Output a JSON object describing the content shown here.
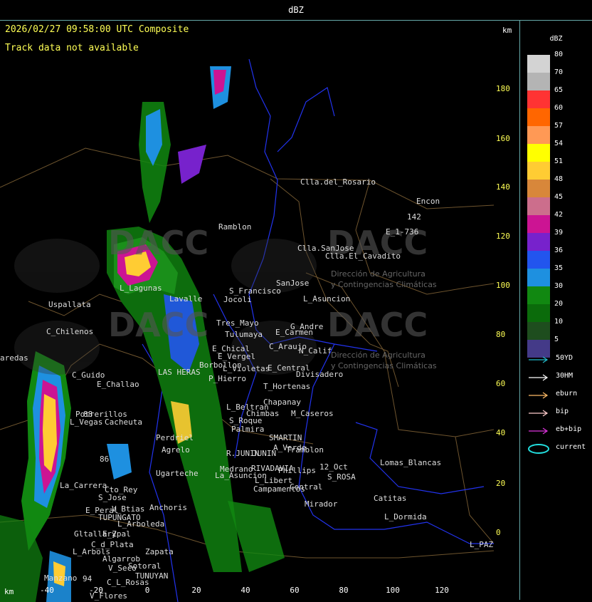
{
  "window": {
    "title": "dBZ"
  },
  "map": {
    "timestamp": "2026/02/27 09:58:00 UTC Composite",
    "track_status": "Track data not available",
    "unit_top": "km",
    "unit_bottom": "km",
    "y_ticks": [
      "180",
      "160",
      "140",
      "120",
      "100",
      "80",
      "60",
      "40",
      "20",
      "0"
    ],
    "x_ticks": [
      "-40",
      "-20",
      "0",
      "20",
      "40",
      "60",
      "80",
      "100",
      "120"
    ],
    "watermark": "DACC",
    "watermark_sub": [
      "Dirección de Agricultura",
      "y Contingencias Climáticas"
    ],
    "places": [
      {
        "name": "Clla.del_Rosario"
      },
      {
        "name": "Encon"
      },
      {
        "name": "142"
      },
      {
        "name": "E_1-736"
      },
      {
        "name": "Ramblon"
      },
      {
        "name": "Clla.SanJose"
      },
      {
        "name": "Clla.El_Cavadito"
      },
      {
        "name": "SanJose"
      },
      {
        "name": "S_Francisco"
      },
      {
        "name": "L_Asuncion"
      },
      {
        "name": "Jocoli"
      },
      {
        "name": "Uspallata"
      },
      {
        "name": "L_Lagunas"
      },
      {
        "name": "Lavalle"
      },
      {
        "name": "Tres_Mayo"
      },
      {
        "name": "G_Andre"
      },
      {
        "name": "E_Carmen"
      },
      {
        "name": "Tulumaya"
      },
      {
        "name": "C_Chilenos"
      },
      {
        "name": "E_Chical"
      },
      {
        "name": "E_Vergel"
      },
      {
        "name": "C_Araujo"
      },
      {
        "name": "N_Calif"
      },
      {
        "name": "aredas"
      },
      {
        "name": "Borbollon"
      },
      {
        "name": "L_Violetas"
      },
      {
        "name": "E_Central"
      },
      {
        "name": "Divisadero"
      },
      {
        "name": "C_Guido"
      },
      {
        "name": "E_Challao"
      },
      {
        "name": "P_Hierro"
      },
      {
        "name": "LAS HERAS"
      },
      {
        "name": "T_Hortenas"
      },
      {
        "name": "Chapanay"
      },
      {
        "name": "L_Beltran"
      },
      {
        "name": "Chimbas"
      },
      {
        "name": "M_Caseros"
      },
      {
        "name": "Potrerillos"
      },
      {
        "name": "L_Vegas"
      },
      {
        "name": "Cacheuta"
      },
      {
        "name": "S_Roque"
      },
      {
        "name": "Palmira"
      },
      {
        "name": "Perdriel"
      },
      {
        "name": "SMARTIN"
      },
      {
        "name": "A_Verde"
      },
      {
        "name": "Tramblon"
      },
      {
        "name": "Agrelo"
      },
      {
        "name": "R.JUNIN"
      },
      {
        "name": "JUNIN"
      },
      {
        "name": "12_Oct"
      },
      {
        "name": "Lomas_Blancas"
      },
      {
        "name": "Medrano"
      },
      {
        "name": "RIVADAVIA"
      },
      {
        "name": "Phillips"
      },
      {
        "name": "Ugarteche"
      },
      {
        "name": "La_Asuncion"
      },
      {
        "name": "S_ROSA"
      },
      {
        "name": "La_Carrera"
      },
      {
        "name": "Cto_Rey"
      },
      {
        "name": "L_Libert"
      },
      {
        "name": "Campamentos"
      },
      {
        "name": "Central"
      },
      {
        "name": "S_Jose"
      },
      {
        "name": "Catitas"
      },
      {
        "name": "Anchoris"
      },
      {
        "name": "E_Peral"
      },
      {
        "name": "V_Btias"
      },
      {
        "name": "TUPUNGATO"
      },
      {
        "name": "Mirador"
      },
      {
        "name": "L_Dormida"
      },
      {
        "name": "L_Arboleda"
      },
      {
        "name": "E_Zpal"
      },
      {
        "name": "Gltallary"
      },
      {
        "name": "L_PAZ"
      },
      {
        "name": "C_d_Plata"
      },
      {
        "name": "L_Arbols"
      },
      {
        "name": "Zapata"
      },
      {
        "name": "Algarrob"
      },
      {
        "name": "V_Seco"
      },
      {
        "name": "Sotoral"
      },
      {
        "name": "TUNUYAN"
      },
      {
        "name": "Manzano"
      },
      {
        "name": "94"
      },
      {
        "name": "C_L_Rosas"
      },
      {
        "name": "V_Flores"
      },
      {
        "name": "88"
      },
      {
        "name": "86"
      }
    ]
  },
  "legend": {
    "title": "dBZ",
    "scale": [
      {
        "label": "80",
        "color": "#d3d3d3"
      },
      {
        "label": "70",
        "color": "#b4b4b4"
      },
      {
        "label": "65",
        "color": "#ff3333"
      },
      {
        "label": "60",
        "color": "#ff6600"
      },
      {
        "label": "57",
        "color": "#ff9955"
      },
      {
        "label": "54",
        "color": "#ffff00"
      },
      {
        "label": "51",
        "color": "#ffcc33"
      },
      {
        "label": "48",
        "color": "#d8873a"
      },
      {
        "label": "45",
        "color": "#cc6e8c"
      },
      {
        "label": "42",
        "color": "#cc1493"
      },
      {
        "label": "39",
        "color": "#7722cc"
      },
      {
        "label": "36",
        "color": "#2255ee"
      },
      {
        "label": "35",
        "color": "#1e90e0"
      },
      {
        "label": "30",
        "color": "#118811"
      },
      {
        "label": "20",
        "color": "#0b6b0b"
      },
      {
        "label": "10",
        "color": "#1e4d1e"
      },
      {
        "label": "5",
        "color": "#443a88"
      }
    ],
    "tracks": [
      {
        "label": "50YD",
        "color": "#22bbcc"
      },
      {
        "label": "30HM",
        "color": "#ffffff"
      },
      {
        "label": "eburn",
        "color": "#ffbb66"
      },
      {
        "label": "bip",
        "color": "#ffcccc"
      },
      {
        "label": "eb+bip",
        "color": "#dd33dd"
      },
      {
        "label": "current",
        "color": "#22dddd"
      }
    ]
  }
}
